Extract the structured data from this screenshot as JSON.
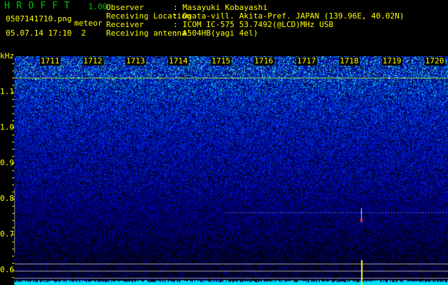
{
  "header": {
    "app_name": "HROFFT",
    "version": "1.00",
    "filename": "0507141710.png",
    "datetime": "05.07.14 17:10",
    "meteor_label": "meteor",
    "meteor_count": "2",
    "info": [
      {
        "label": "Observer",
        "value": ": Masayuki Kobayashi"
      },
      {
        "label": "Receiving Location",
        "value": ": Ogata-vill. Akita-Pref. JAPAN (139.96E, 40.02N)"
      },
      {
        "label": "Receiver",
        "value": ": ICOM IC-575 53.7492(@LCD)MHz USB"
      },
      {
        "label": "Receiving antenna",
        "value": ": A504HB(yagi 4el)"
      }
    ]
  },
  "chart_data": {
    "type": "heatmap",
    "ylabel": "kHz",
    "x_ticks": [
      "1711",
      "1712",
      "1713",
      "1714",
      "1715",
      "1716",
      "1717",
      "1718",
      "1719",
      "1720"
    ],
    "y_ticks": [
      "1.1",
      "1.0",
      "0.9",
      "0.8",
      "0.7",
      "0.6"
    ],
    "ylim": [
      0.56,
      1.2
    ],
    "colors": {
      "background": "#000000",
      "low": "#0000a0",
      "mid": "#2050ff",
      "high": "#00ffc0",
      "carrier": "#c0ff40",
      "meteor": "#ffff00"
    },
    "carrier_freq_khz": 1.14,
    "meteor_events": [
      {
        "time": "1718",
        "freq_khz": 0.76
      }
    ]
  }
}
